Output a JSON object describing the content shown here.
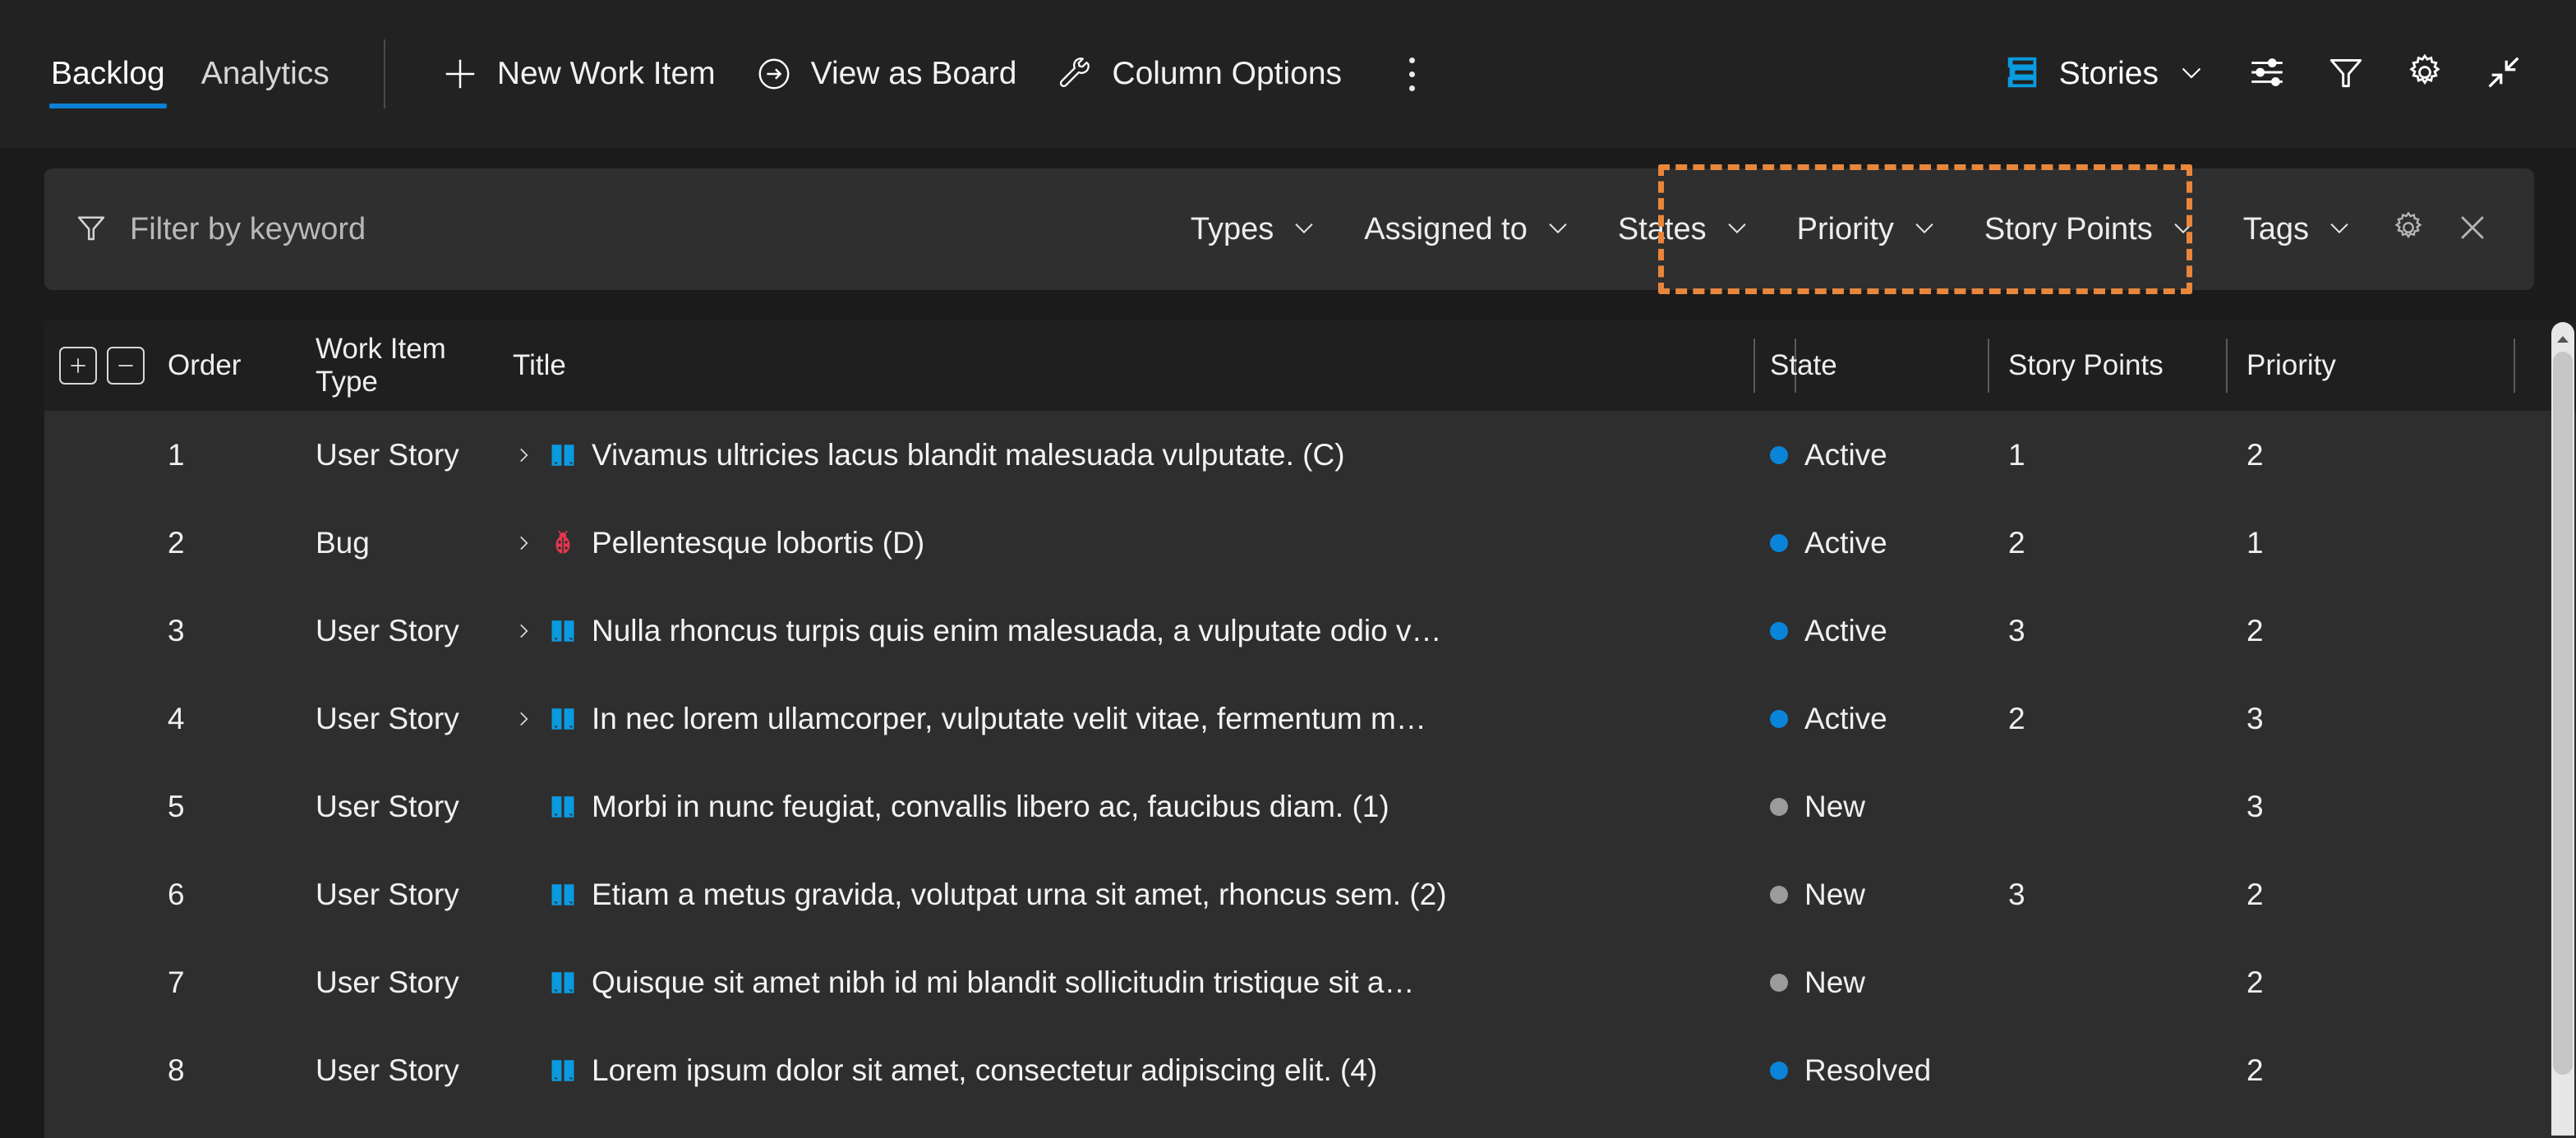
{
  "colors": {
    "accent_blue": "#0d7fd6",
    "story_icon_blue": "#0a9ae0",
    "bug_icon_red": "#e63650",
    "highlight_orange": "#e8863c",
    "state_active": "#0a84d8",
    "state_new": "#9b9b9b",
    "state_resolved": "#0a84d8",
    "toolbar_bg": "#222222",
    "filterbar_bg": "#2f2f2f",
    "grid_row_bg": "#2e2e2e"
  },
  "tabs": [
    {
      "label": "Backlog",
      "active": true
    },
    {
      "label": "Analytics",
      "active": false
    }
  ],
  "toolbar": {
    "new_work_item": "New Work Item",
    "view_as_board": "View as Board",
    "column_options": "Column Options",
    "more_label": "More options",
    "backlog_level": "Stories",
    "icons": {
      "new": "plus-icon",
      "board": "arrow-right-circle-icon",
      "column_options": "wrench-icon",
      "more": "kebab-menu-icon",
      "level": "backlog-levels-icon",
      "level_chevron": "chevron-down-icon",
      "view_options": "sliders-icon",
      "filter": "filter-funnel-icon",
      "settings": "gear-icon",
      "fullscreen": "exit-fullscreen-icon"
    }
  },
  "filter": {
    "keyword_placeholder": "Filter by keyword",
    "keyword_value": "",
    "keyword_icon": "filter-funnel-icon",
    "pills": [
      {
        "label": "Types",
        "highlighted": false
      },
      {
        "label": "Assigned to",
        "highlighted": false
      },
      {
        "label": "States",
        "highlighted": false
      },
      {
        "label": "Priority",
        "highlighted": true
      },
      {
        "label": "Story Points",
        "highlighted": true
      },
      {
        "label": "Tags",
        "highlighted": false
      }
    ],
    "settings_icon": "gear-icon",
    "close_icon": "close-icon"
  },
  "grid": {
    "expand_all_label": "+",
    "collapse_all_label": "−",
    "columns": [
      {
        "key": "order",
        "label": "Order"
      },
      {
        "key": "type",
        "label": "Work Item Type"
      },
      {
        "key": "title",
        "label": "Title"
      },
      {
        "key": "state",
        "label": "State"
      },
      {
        "key": "points",
        "label": "Story Points"
      },
      {
        "key": "prio",
        "label": "Priority"
      }
    ],
    "rows": [
      {
        "order": "1",
        "type": "User Story",
        "icon": "user-story-book-icon",
        "expandable": true,
        "title": "Vivamus ultricies lacus blandit malesuada vulputate. (C)",
        "state": "Active",
        "state_color": "#0a84d8",
        "points": "1",
        "priority": "2"
      },
      {
        "order": "2",
        "type": "Bug",
        "icon": "bug-ladybug-icon",
        "expandable": true,
        "title": "Pellentesque lobortis (D)",
        "state": "Active",
        "state_color": "#0a84d8",
        "points": "2",
        "priority": "1"
      },
      {
        "order": "3",
        "type": "User Story",
        "icon": "user-story-book-icon",
        "expandable": true,
        "title": "Nulla rhoncus turpis quis enim malesuada, a vulputate odio v…",
        "state": "Active",
        "state_color": "#0a84d8",
        "points": "3",
        "priority": "2"
      },
      {
        "order": "4",
        "type": "User Story",
        "icon": "user-story-book-icon",
        "expandable": true,
        "title": "In nec lorem ullamcorper, vulputate velit vitae, fermentum m…",
        "state": "Active",
        "state_color": "#0a84d8",
        "points": "2",
        "priority": "3"
      },
      {
        "order": "5",
        "type": "User Story",
        "icon": "user-story-book-icon",
        "expandable": false,
        "title": "Morbi in nunc feugiat, convallis libero ac, faucibus diam. (1)",
        "state": "New",
        "state_color": "#9b9b9b",
        "points": "",
        "priority": "3"
      },
      {
        "order": "6",
        "type": "User Story",
        "icon": "user-story-book-icon",
        "expandable": false,
        "title": "Etiam a metus gravida, volutpat urna sit amet, rhoncus sem. (2)",
        "state": "New",
        "state_color": "#9b9b9b",
        "points": "3",
        "priority": "2"
      },
      {
        "order": "7",
        "type": "User Story",
        "icon": "user-story-book-icon",
        "expandable": false,
        "title": "Quisque sit amet nibh id mi blandit sollicitudin tristique sit a…",
        "state": "New",
        "state_color": "#9b9b9b",
        "points": "",
        "priority": "2"
      },
      {
        "order": "8",
        "type": "User Story",
        "icon": "user-story-book-icon",
        "expandable": false,
        "title": "Lorem ipsum dolor sit amet, consectetur adipiscing elit. (4)",
        "state": "Resolved",
        "state_color": "#0a84d8",
        "points": "",
        "priority": "2"
      }
    ]
  }
}
